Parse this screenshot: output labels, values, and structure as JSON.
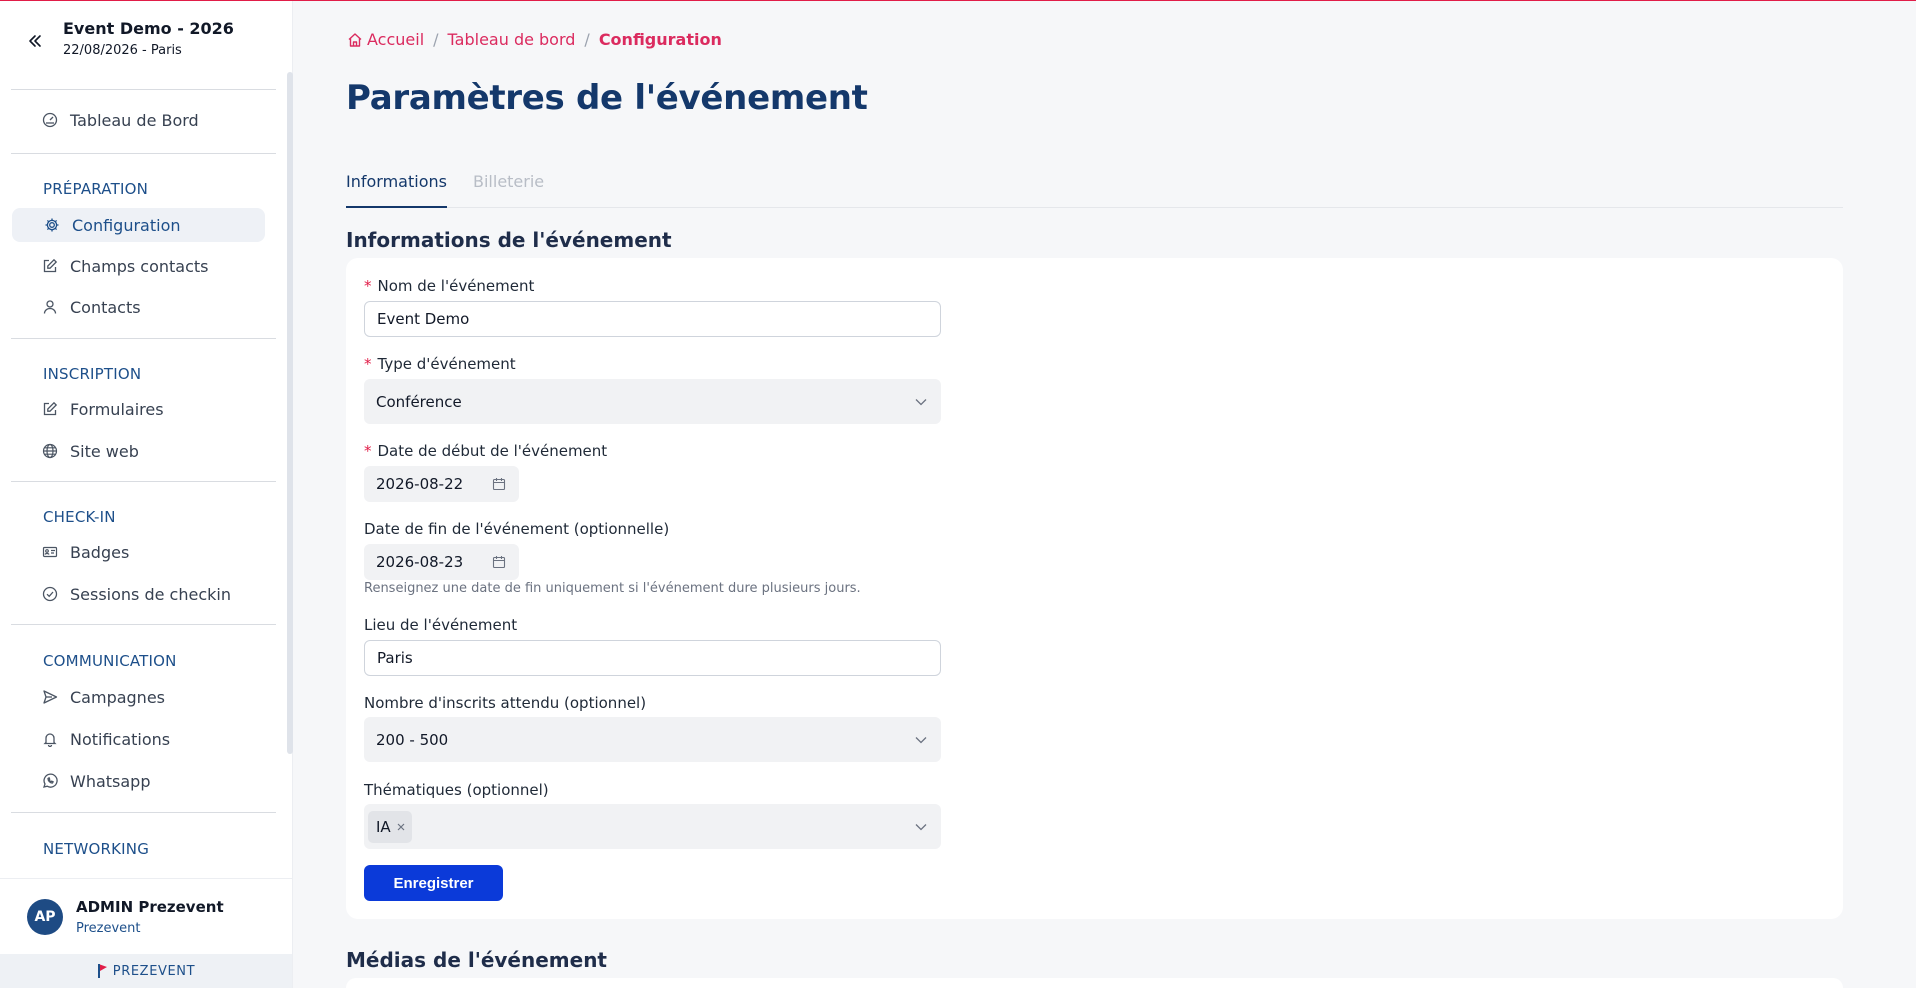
{
  "sidebar": {
    "event_title": "Event Demo - 2026",
    "event_subtitle": "22/08/2026 - Paris",
    "dashboard_label": "Tableau de Bord",
    "sections": {
      "preparation": "PRÉPARATION",
      "inscription": "INSCRIPTION",
      "checkin": "CHECK-IN",
      "communication": "COMMUNICATION",
      "networking": "NETWORKING"
    },
    "items": {
      "configuration": "Configuration",
      "champs_contacts": "Champs contacts",
      "contacts": "Contacts",
      "formulaires": "Formulaires",
      "site_web": "Site web",
      "badges": "Badges",
      "sessions_checkin": "Sessions de checkin",
      "campagnes": "Campagnes",
      "notifications": "Notifications",
      "whatsapp": "Whatsapp"
    },
    "user": {
      "initials": "AP",
      "name": "ADMIN Prezevent",
      "org": "Prezevent"
    },
    "brand": "PREZEVENT"
  },
  "breadcrumb": {
    "home": "Accueil",
    "dashboard": "Tableau de bord",
    "current": "Configuration",
    "separator": "/"
  },
  "page": {
    "title": "Paramètres de l'événement"
  },
  "tabs": {
    "informations": "Informations",
    "billeterie": "Billeterie"
  },
  "form": {
    "section_title": "Informations de l'événement",
    "required_mark": "*",
    "name_label": "Nom de l'événement",
    "name_value": "Event Demo",
    "type_label": "Type d'événement",
    "type_value": "Conférence",
    "start_label": "Date de début de l'événement",
    "start_value": "2026-08-22",
    "end_label": "Date de fin de l'événement (optionnelle)",
    "end_value": "2026-08-23",
    "end_hint": "Renseignez une date de fin uniquement si l'événement dure plusieurs jours.",
    "place_label": "Lieu de l'événement",
    "place_value": "Paris",
    "attendees_label": "Nombre d'inscrits attendu (optionnel)",
    "attendees_value": "200 - 500",
    "themes_label": "Thématiques (optionnel)",
    "themes_tags": [
      "IA"
    ],
    "save_label": "Enregistrer"
  },
  "media": {
    "section_title": "Médias de l'événement"
  },
  "colors": {
    "accent_pink": "#db2b5f",
    "navy": "#14386b",
    "primary_button": "#0b3ad9",
    "section_blue": "#1d4f8a"
  }
}
